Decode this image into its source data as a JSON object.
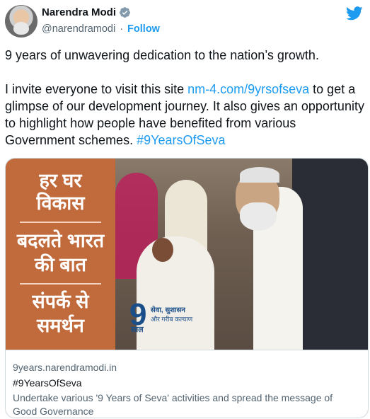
{
  "author": {
    "name": "Narendra Modi",
    "handle": "@narendramodi",
    "separator": "·",
    "follow_label": "Follow"
  },
  "tweet": {
    "line1": "9 years of unwavering dedication to the nation’s growth.",
    "para2_before": "I invite everyone to visit this site ",
    "para2_link": "nm-4.com/9yrsofseva",
    "para2_after": " to get a glimpse of our development journey. It also gives an opportunity to highlight how people have benefited from various Government schemes. ",
    "hashtag": "#9YearsOfSeva"
  },
  "card": {
    "panel_lines": [
      "हर घर",
      "विकास",
      "बदलते भारत",
      "की बात",
      "संपर्क से",
      "समर्थन"
    ],
    "logo_number": "9",
    "logo_saal": "साल",
    "logo_tag1": "सेवा, सुशासन",
    "logo_tag2": "और गरीब कल्याण",
    "domain": "9years.narendramodi.in",
    "title": "#9YearsOfSeva",
    "description": "Undertake various '9 Years of Seva' activities and spread the message of Good Governance"
  },
  "colors": {
    "accent": "#1d9bf0",
    "panel": "#c16a3c",
    "logo_blue": "#1b4f8a"
  },
  "icons": [
    "verified-badge-icon",
    "twitter-bird-icon"
  ]
}
